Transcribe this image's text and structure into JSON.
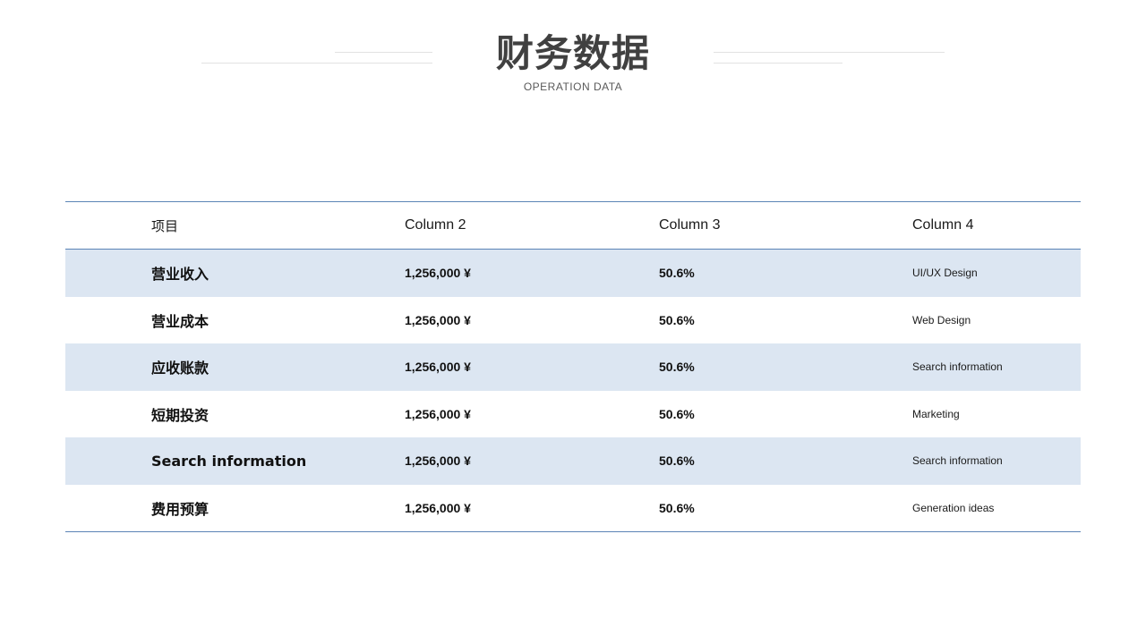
{
  "slide": {
    "title": "财务数据",
    "subtitle": "OPERATION DATA"
  },
  "table": {
    "headers": [
      "项目",
      "Column 2",
      "Column 3",
      "Column 4"
    ],
    "rows": [
      [
        "营业收入",
        "1,256,000 ¥",
        "50.6%",
        "UI/UX Design"
      ],
      [
        "营业成本",
        "1,256,000 ¥",
        "50.6%",
        "Web Design"
      ],
      [
        "应收账款",
        "1,256,000 ¥",
        "50.6%",
        "Search information"
      ],
      [
        "短期投资",
        "1,256,000 ¥",
        "50.6%",
        "Marketing"
      ],
      [
        "Search information",
        "1,256,000 ¥",
        "50.6%",
        "Search information"
      ],
      [
        "费用预算",
        "1,256,000 ¥",
        "50.6%",
        "Generation ideas"
      ]
    ]
  },
  "colors": {
    "accent_line": "#5b84b6",
    "shaded_row": "#dce6f2",
    "title": "#404040"
  }
}
